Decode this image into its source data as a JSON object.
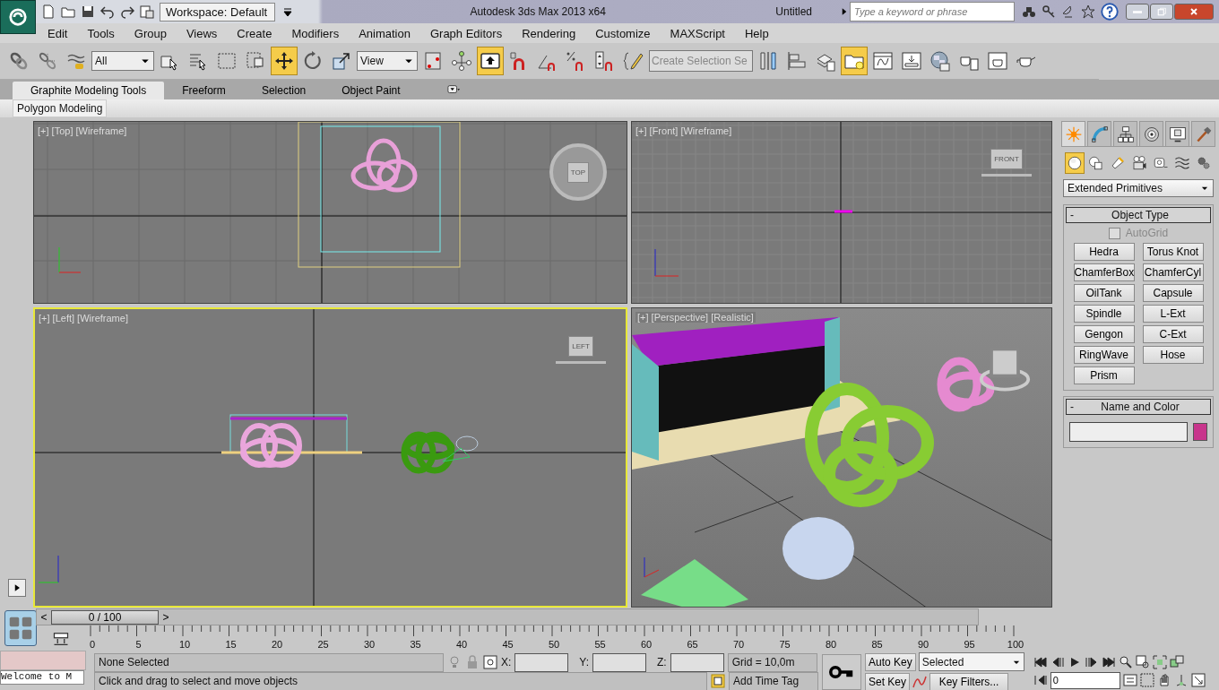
{
  "window": {
    "workspace": "Workspace: Default",
    "app_title": "Autodesk 3ds Max  2013 x64",
    "document_title": "Untitled",
    "search_placeholder": "Type a keyword or phrase"
  },
  "menu": [
    "Edit",
    "Tools",
    "Group",
    "Views",
    "Create",
    "Modifiers",
    "Animation",
    "Graph Editors",
    "Rendering",
    "Customize",
    "MAXScript",
    "Help"
  ],
  "main_toolbar": [
    {
      "kind": "link",
      "selected": false
    },
    {
      "kind": "unlink",
      "selected": false
    },
    {
      "kind": "bind",
      "selected": false
    },
    {
      "kind": "dropdown",
      "value": "All"
    },
    {
      "kind": "select-object",
      "selected": false
    },
    {
      "kind": "select-by-name",
      "selected": false
    },
    {
      "kind": "rect-region",
      "selected": false
    },
    {
      "kind": "window-crossing",
      "selected": false
    },
    {
      "kind": "move",
      "selected": true
    },
    {
      "kind": "rotate",
      "selected": false
    },
    {
      "kind": "scale",
      "selected": false
    },
    {
      "kind": "dropdown",
      "value": "View"
    },
    {
      "kind": "pivot",
      "selected": false
    },
    {
      "kind": "manipulate",
      "selected": false
    },
    {
      "kind": "keyboard-override",
      "selected": true
    },
    {
      "kind": "snap",
      "selected": false
    },
    {
      "kind": "angle-snap",
      "selected": false
    },
    {
      "kind": "percent-snap",
      "selected": false
    },
    {
      "kind": "spinner-snap",
      "selected": false
    },
    {
      "kind": "edit-named",
      "selected": false
    },
    {
      "kind": "field",
      "placeholder": "Create Selection Se"
    },
    {
      "kind": "mirror",
      "selected": false
    },
    {
      "kind": "align",
      "selected": false
    },
    {
      "kind": "layers",
      "selected": false
    },
    {
      "kind": "scene-explorer",
      "selected": true
    },
    {
      "kind": "curve-editor",
      "selected": false
    },
    {
      "kind": "schematic",
      "selected": false
    },
    {
      "kind": "material",
      "selected": false
    },
    {
      "kind": "render-setup",
      "selected": false
    },
    {
      "kind": "render-frame",
      "selected": false
    },
    {
      "kind": "render",
      "selected": false
    }
  ],
  "ribbon": {
    "tabs": [
      {
        "label": "Graphite Modeling Tools",
        "selected": true
      },
      {
        "label": "Freeform",
        "selected": false
      },
      {
        "label": "Selection",
        "selected": false
      },
      {
        "label": "Object Paint",
        "selected": false
      }
    ],
    "panel_label": "Polygon Modeling"
  },
  "viewports": [
    {
      "kind": "top",
      "label": "[+] [Top] [Wireframe]",
      "cube_label": "TOP",
      "selected": false
    },
    {
      "kind": "front",
      "label": "[+] [Front] [Wireframe]",
      "cube_label": "FRONT",
      "selected": false
    },
    {
      "kind": "left",
      "label": "[+] [Left] [Wireframe]",
      "cube_label": "LEFT",
      "selected": true
    },
    {
      "kind": "perspective",
      "label": "[+] [Perspective] [Realistic]",
      "selected": false
    }
  ],
  "command_panel": {
    "tabs": [
      {
        "kind": "create",
        "selected": true
      },
      {
        "kind": "modify",
        "selected": false
      },
      {
        "kind": "hierarchy",
        "selected": false
      },
      {
        "kind": "motion",
        "selected": false
      },
      {
        "kind": "display",
        "selected": false
      },
      {
        "kind": "utilities",
        "selected": false
      }
    ],
    "categories": [
      {
        "kind": "geometry",
        "selected": true
      },
      {
        "kind": "shapes",
        "selected": false
      },
      {
        "kind": "lights",
        "selected": false
      },
      {
        "kind": "cameras",
        "selected": false
      },
      {
        "kind": "helpers",
        "selected": false
      },
      {
        "kind": "space-warps",
        "selected": false
      },
      {
        "kind": "systems",
        "selected": false
      }
    ],
    "dropdown": "Extended Primitives",
    "object_type": {
      "sign": "-",
      "title": "Object Type",
      "autogrid": {
        "label": "AutoGrid",
        "checked": false,
        "disabled": true
      },
      "buttons": [
        "Hedra",
        "Torus Knot",
        "ChamferBox",
        "ChamferCyl",
        "OilTank",
        "Capsule",
        "Spindle",
        "L-Ext",
        "Gengon",
        "C-Ext",
        "RingWave",
        "Hose",
        "Prism"
      ]
    },
    "name_color": {
      "sign": "-",
      "title": "Name and Color",
      "color": "#c8358c"
    }
  },
  "time_slider": {
    "prev": "<",
    "value": "0 / 100",
    "next": ">",
    "level": 0
  },
  "timeline": [
    "0",
    "5",
    "10",
    "15",
    "20",
    "25",
    "30",
    "35",
    "40",
    "45",
    "50",
    "55",
    "60",
    "65",
    "70",
    "75",
    "80",
    "85",
    "90",
    "95",
    "100"
  ],
  "status": {
    "selection": "None Selected",
    "x_label": "X:",
    "y_label": "Y:",
    "z_label": "Z:",
    "grid": "Grid = 10,0m",
    "auto_key": "Auto Key",
    "key_mode": "Selected",
    "set_key": "Set Key",
    "key_filters": "Key Filters...",
    "add_time_tag": "Add Time Tag",
    "prompt": "Click and drag to select and move objects",
    "listener": "Welcome to M",
    "frame": "0"
  }
}
